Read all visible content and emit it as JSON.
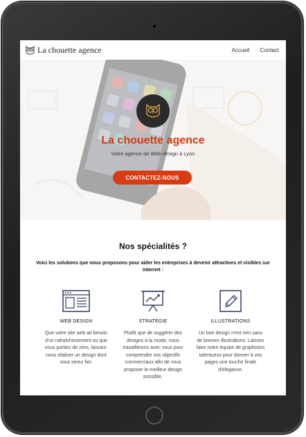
{
  "brand": {
    "name": "La chouette agence",
    "logo_icon": "owl-icon"
  },
  "nav": {
    "items": [
      {
        "label": "Accueil"
      },
      {
        "label": "Contact"
      }
    ]
  },
  "hero": {
    "badge_icon": "owl-icon",
    "title": "La chouette agence",
    "subtitle": "Votre agence de Web design à Lyon",
    "cta_label": "CONTACTEZ-NOUS"
  },
  "specialities": {
    "title": "Nos spécialités ?",
    "intro": "Voici les solutions que nous proposons pour aider les entreprises à devenir attractives et visibles sur internet :",
    "items": [
      {
        "icon": "browser-window-icon",
        "title": "WEB DESIGN",
        "text": "Que votre site web ait besoin d'un rafraîchissement ou que vous partiez de zéro, laissez-nous réaliser un design dont vous serez fier."
      },
      {
        "icon": "presentation-chart-icon",
        "title": "STRATÉGIE",
        "text": "Plutôt que de suggérer des designs à la mode, nous travaillerons avec vous pour comprendre vos objectifs commerciaux afin de vous proposer le meilleur design possible."
      },
      {
        "icon": "pencil-icon",
        "title": "ILLUSTRATIONS",
        "text": "Un bon design n'est rien sans de bonnes illustrations. Laissez faire notre équipe de graphistes talentueux pour donner à vos pages une touche finale d'élégance."
      }
    ]
  },
  "colors": {
    "accent": "#d93a0f",
    "title_orange": "#d53a12",
    "frame": "#2a2a2a",
    "icon_navy": "#2e3a5c"
  }
}
